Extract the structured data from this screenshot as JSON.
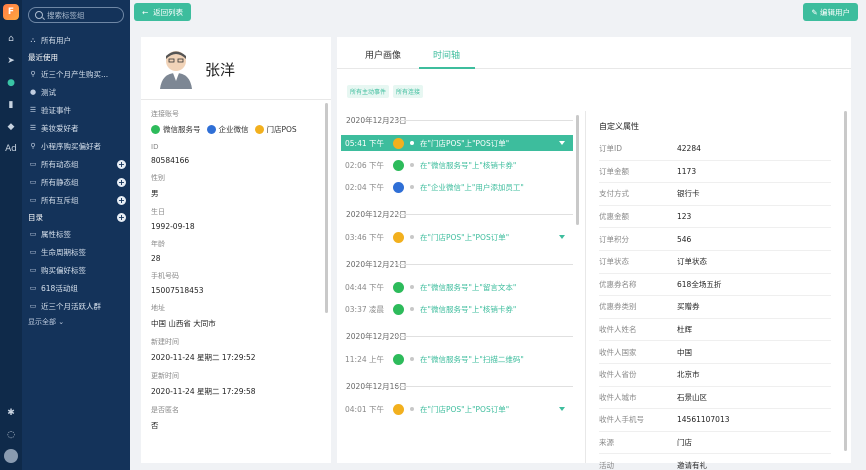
{
  "rail": {
    "logo": "F",
    "items": [
      "home-icon",
      "send-icon",
      "user-icon",
      "chart-icon",
      "chat-icon",
      "ad-icon"
    ],
    "ad_label": "Ad"
  },
  "sidebar": {
    "search_placeholder": "搜索标签组",
    "all_users": "所有用户",
    "recent_title": "最近使用",
    "recent": [
      "近三个月产生购买...",
      "测试",
      "验证事件",
      "美妆爱好者",
      "小程序购买偏好者"
    ],
    "groups": [
      "所有动态组",
      "所有静态组",
      "所有互斥组"
    ],
    "catalog_title": "目录",
    "catalog": [
      "属性标签",
      "生命周期标签",
      "购买偏好标签",
      "618活动组",
      "近三个月活跃人群"
    ],
    "show_all": "显示全部"
  },
  "topbar": {
    "back_label": "返回列表",
    "edit_label": "编辑用户"
  },
  "profile": {
    "name": "张洋",
    "linked_label": "连接账号",
    "channels": [
      {
        "name": "微信服务号",
        "color": "#2dbb5b"
      },
      {
        "name": "企业微信",
        "color": "#2f6fd6"
      },
      {
        "name": "门店POS",
        "color": "#f2b01e"
      }
    ],
    "fields": [
      {
        "label": "ID",
        "value": "80584166"
      },
      {
        "label": "性别",
        "value": "男"
      },
      {
        "label": "生日",
        "value": "1992-09-18"
      },
      {
        "label": "年龄",
        "value": "28"
      },
      {
        "label": "手机号码",
        "value": "15007518453"
      },
      {
        "label": "地址",
        "value": "中国 山西省 大同市"
      },
      {
        "label": "新建时间",
        "value": "2020-11-24 星期二 17:29:52"
      },
      {
        "label": "更新时间",
        "value": "2020-11-24 星期二 17:29:58"
      },
      {
        "label": "是否匿名",
        "value": "否"
      }
    ]
  },
  "main": {
    "tabs": [
      "用户画像",
      "时间轴"
    ],
    "active_tab": "时间轴",
    "filters": [
      "所有主动事件",
      "所有连接"
    ],
    "timeline": [
      {
        "date": "2020年12月23日",
        "events": [
          {
            "time": "05:41 下午",
            "text": "在\"门店POS\"上\"POS订单\"",
            "source": "pos",
            "highlight": true,
            "expand": true
          },
          {
            "time": "02:06 下午",
            "text": "在\"微信服务号\"上\"核销卡券\"",
            "source": "wechat",
            "highlight": false,
            "expand": false
          },
          {
            "time": "02:04 下午",
            "text": "在\"企业微信\"上\"用户添加员工\"",
            "source": "wecom",
            "highlight": false,
            "expand": false
          }
        ]
      },
      {
        "date": "2020年12月22日",
        "events": [
          {
            "time": "03:46 下午",
            "text": "在\"门店POS\"上\"POS订单\"",
            "source": "pos",
            "highlight": false,
            "expand": true
          }
        ]
      },
      {
        "date": "2020年12月21日",
        "events": [
          {
            "time": "04:44 下午",
            "text": "在\"微信服务号\"上\"留言文本\"",
            "source": "wechat",
            "highlight": false,
            "expand": false
          },
          {
            "time": "03:37 凌晨",
            "text": "在\"微信服务号\"上\"核销卡券\"",
            "source": "wechat",
            "highlight": false,
            "expand": false
          }
        ]
      },
      {
        "date": "2020年12月20日",
        "events": [
          {
            "time": "11:24 上午",
            "text": "在\"微信服务号\"上\"扫描二维码\"",
            "source": "wechat",
            "highlight": false,
            "expand": false
          }
        ]
      },
      {
        "date": "2020年12月16日",
        "events": [
          {
            "time": "04:01 下午",
            "text": "在\"门店POS\"上\"POS订单\"",
            "source": "pos",
            "highlight": false,
            "expand": true
          }
        ]
      }
    ],
    "attrs_title": "自定义属性",
    "attrs": [
      {
        "key": "订单ID",
        "value": "42284"
      },
      {
        "key": "订单金额",
        "value": "1173"
      },
      {
        "key": "支付方式",
        "value": "银行卡"
      },
      {
        "key": "优惠金额",
        "value": "123"
      },
      {
        "key": "订单积分",
        "value": "546"
      },
      {
        "key": "订单状态",
        "value": "订单状态"
      },
      {
        "key": "优惠券名称",
        "value": "618全场五折"
      },
      {
        "key": "优惠券类别",
        "value": "买赠券"
      },
      {
        "key": "收件人姓名",
        "value": "杜辉"
      },
      {
        "key": "收件人国家",
        "value": "中国"
      },
      {
        "key": "收件人省份",
        "value": "北京市"
      },
      {
        "key": "收件人城市",
        "value": "石景山区"
      },
      {
        "key": "收件人手机号",
        "value": "14561107013"
      },
      {
        "key": "来源",
        "value": "门店"
      },
      {
        "key": "活动",
        "value": "邀请有礼"
      }
    ]
  },
  "colors": {
    "accent": "#3dbd9d",
    "sidebar": "#14335a",
    "rail": "#0f2a4a",
    "wechat": "#2dbb5b",
    "wecom": "#2f6fd6",
    "pos": "#f2b01e"
  }
}
